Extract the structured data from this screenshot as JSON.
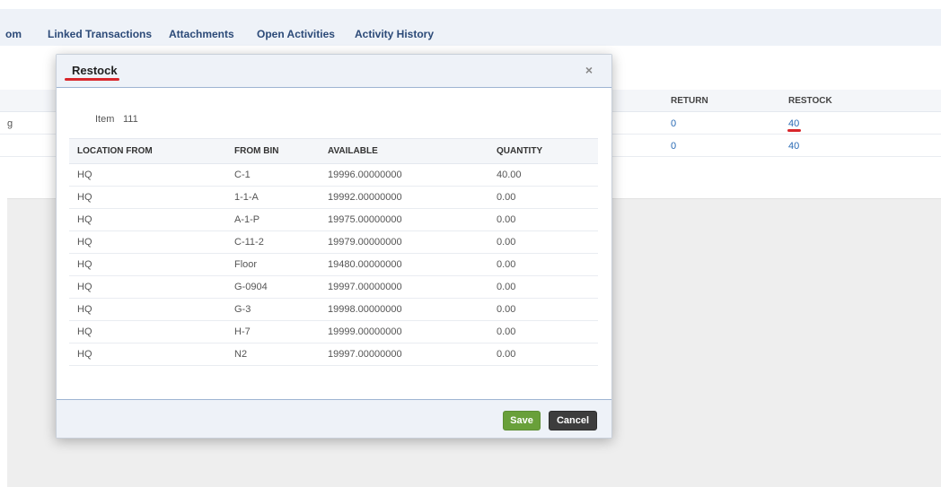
{
  "tabs": [
    {
      "label": "om"
    },
    {
      "label": "Linked Transactions"
    },
    {
      "label": "Attachments"
    },
    {
      "label": "Open Activities"
    },
    {
      "label": "Activity History"
    }
  ],
  "background_table": {
    "headers": {
      "return": "RETURN",
      "restock": "RESTOCK"
    },
    "rows": [
      {
        "left": "g",
        "return": "0",
        "restock": "40"
      },
      {
        "left": "",
        "return": "0",
        "restock": "40"
      }
    ]
  },
  "modal": {
    "title": "Restock",
    "item_label": "Item",
    "item_value": "111",
    "headers": [
      "LOCATION FROM",
      "FROM BIN",
      "AVAILABLE",
      "QUANTITY"
    ],
    "rows": [
      [
        "HQ",
        "C-1",
        "19996.00000000",
        "40.00"
      ],
      [
        "HQ",
        "1-1-A",
        "19992.00000000",
        "0.00"
      ],
      [
        "HQ",
        "A-1-P",
        "19975.00000000",
        "0.00"
      ],
      [
        "HQ",
        "C-11-2",
        "19979.00000000",
        "0.00"
      ],
      [
        "HQ",
        "Floor",
        "19480.00000000",
        "0.00"
      ],
      [
        "HQ",
        "G-0904",
        "19997.00000000",
        "0.00"
      ],
      [
        "HQ",
        "G-3",
        "19998.00000000",
        "0.00"
      ],
      [
        "HQ",
        "H-7",
        "19999.00000000",
        "0.00"
      ],
      [
        "HQ",
        "N2",
        "19997.00000000",
        "0.00"
      ]
    ],
    "save_label": "Save",
    "cancel_label": "Cancel",
    "close_glyph": "×"
  },
  "colors": {
    "accent_red": "#d8262b",
    "save_green": "#69a03a",
    "link_blue": "#2a6bb5"
  }
}
